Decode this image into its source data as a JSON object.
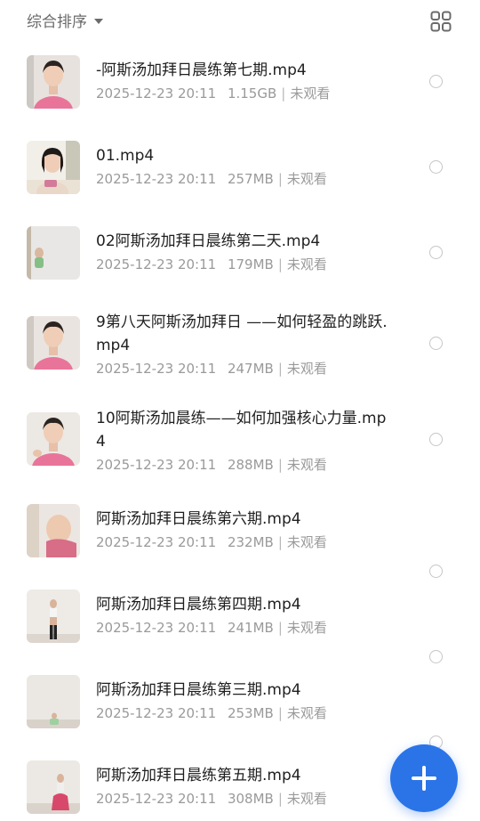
{
  "toolbar": {
    "sort_label": "综合排序",
    "sort_icon": "caret-down-icon",
    "view_toggle_icon": "grid-view-icon"
  },
  "files": [
    {
      "title": "-阿斯汤加拜日晨练第七期.mp4",
      "date": "2025-12-23 20:11",
      "size": "1.15GB",
      "status": "未观看"
    },
    {
      "title": "01.mp4",
      "date": "2025-12-23 20:11",
      "size": "257MB",
      "status": "未观看"
    },
    {
      "title": "02阿斯汤加拜日晨练第二天.mp4",
      "date": "2025-12-23 20:11",
      "size": "179MB",
      "status": "未观看"
    },
    {
      "title": "9第八天阿斯汤加拜日 ——如何轻盈的跳跃.mp4",
      "date": "2025-12-23 20:11",
      "size": "247MB",
      "status": "未观看"
    },
    {
      "title": "10阿斯汤加晨练——如何加强核心力量.mp4",
      "date": "2025-12-23 20:11",
      "size": "288MB",
      "status": "未观看"
    },
    {
      "title": "阿斯汤加拜日晨练第六期.mp4",
      "date": "2025-12-23 20:11",
      "size": "232MB",
      "status": "未观看"
    },
    {
      "title": "阿斯汤加拜日晨练第四期.mp4",
      "date": "2025-12-23 20:11",
      "size": "241MB",
      "status": "未观看"
    },
    {
      "title": "阿斯汤加拜日晨练第三期.mp4",
      "date": "2025-12-23 20:11",
      "size": "253MB",
      "status": "未观看"
    },
    {
      "title": "阿斯汤加拜日晨练第五期.mp4",
      "date": "2025-12-23 20:11",
      "size": "308MB",
      "status": "未观看"
    }
  ],
  "fab": {
    "icon": "plus-icon",
    "color": "#2a74e8"
  },
  "colors": {
    "accent": "#2a74e8",
    "title_text": "#1f1f1f",
    "meta_text": "#9a9a9a"
  }
}
